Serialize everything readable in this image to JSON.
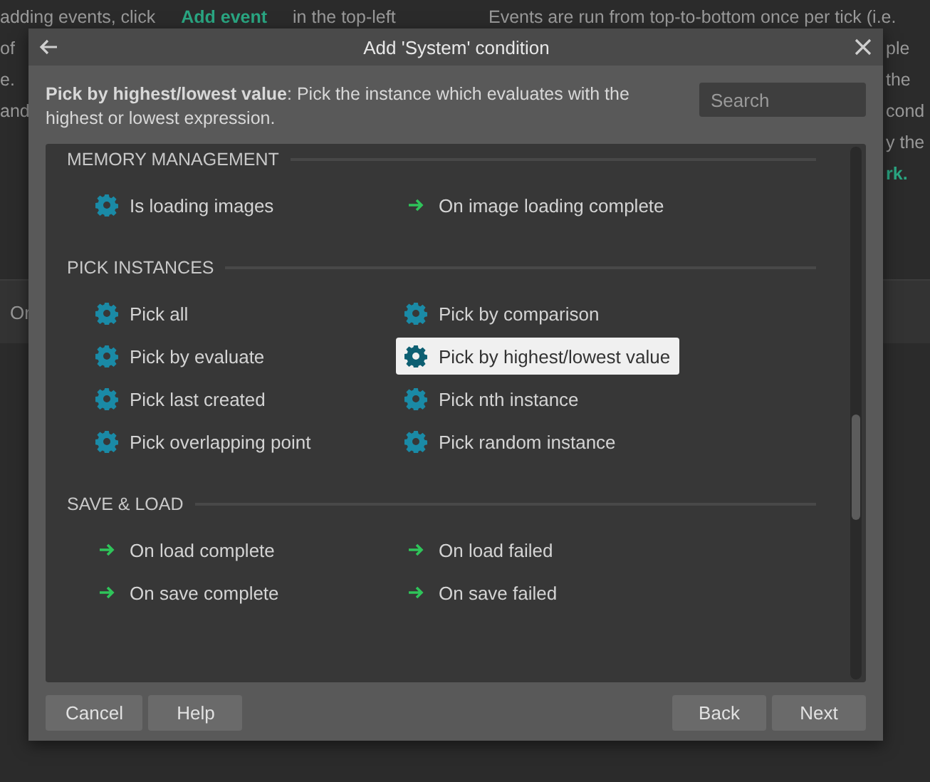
{
  "background_page": {
    "left_lines": [
      {
        "parts": [
          {
            "text": "adding events, click",
            "link": false
          },
          {
            "text": "Add event",
            "link": true
          },
          {
            "text": "in the top-left",
            "link": false
          }
        ]
      },
      {
        "parts": [
          {
            "text": "of",
            "link": false
          }
        ]
      },
      {
        "parts": [
          {
            "text": "e.",
            "link": false
          }
        ]
      },
      {
        "parts": [
          {
            "text": "and",
            "link": false
          }
        ]
      }
    ],
    "right_lines": [
      {
        "text": "Events are run from top-to-bottom once per tick (i.e.",
        "link": false
      },
      {
        "text": "ple",
        "link": false
      },
      {
        "text": "the",
        "link": false
      },
      {
        "text": "cond",
        "link": false
      },
      {
        "text": "y the",
        "link": false
      },
      {
        "text": "rk.",
        "link": true
      }
    ],
    "bar_label": "Or"
  },
  "dialog": {
    "title": "Add 'System' condition",
    "description": "**Pick by highest/lowest value**: Pick the instance which evaluates with the highest or lowest expression.",
    "search": {
      "placeholder": "Search"
    },
    "sections": [
      {
        "title": "MEMORY MANAGEMENT",
        "items": [
          {
            "label": "Is loading images",
            "kind": "condition",
            "selected": false
          },
          {
            "label": "On image loading complete",
            "kind": "trigger",
            "selected": false
          }
        ]
      },
      {
        "title": "PICK INSTANCES",
        "items": [
          {
            "label": "Pick all",
            "kind": "condition",
            "selected": false
          },
          {
            "label": "Pick by comparison",
            "kind": "condition",
            "selected": false
          },
          {
            "label": "Pick by evaluate",
            "kind": "condition",
            "selected": false
          },
          {
            "label": "Pick by highest/lowest value",
            "kind": "condition",
            "selected": true
          },
          {
            "label": "Pick last created",
            "kind": "condition",
            "selected": false
          },
          {
            "label": "Pick nth instance",
            "kind": "condition",
            "selected": false
          },
          {
            "label": "Pick overlapping point",
            "kind": "condition",
            "selected": false
          },
          {
            "label": "Pick random instance",
            "kind": "condition",
            "selected": false
          }
        ]
      },
      {
        "title": "SAVE & LOAD",
        "items": [
          {
            "label": "On load complete",
            "kind": "trigger",
            "selected": false
          },
          {
            "label": "On load failed",
            "kind": "trigger",
            "selected": false
          },
          {
            "label": "On save complete",
            "kind": "trigger",
            "selected": false
          },
          {
            "label": "On save failed",
            "kind": "trigger",
            "selected": false
          }
        ]
      }
    ],
    "left_buttons": [
      "Cancel",
      "Help"
    ],
    "right_buttons": [
      "Back",
      "Next"
    ]
  }
}
